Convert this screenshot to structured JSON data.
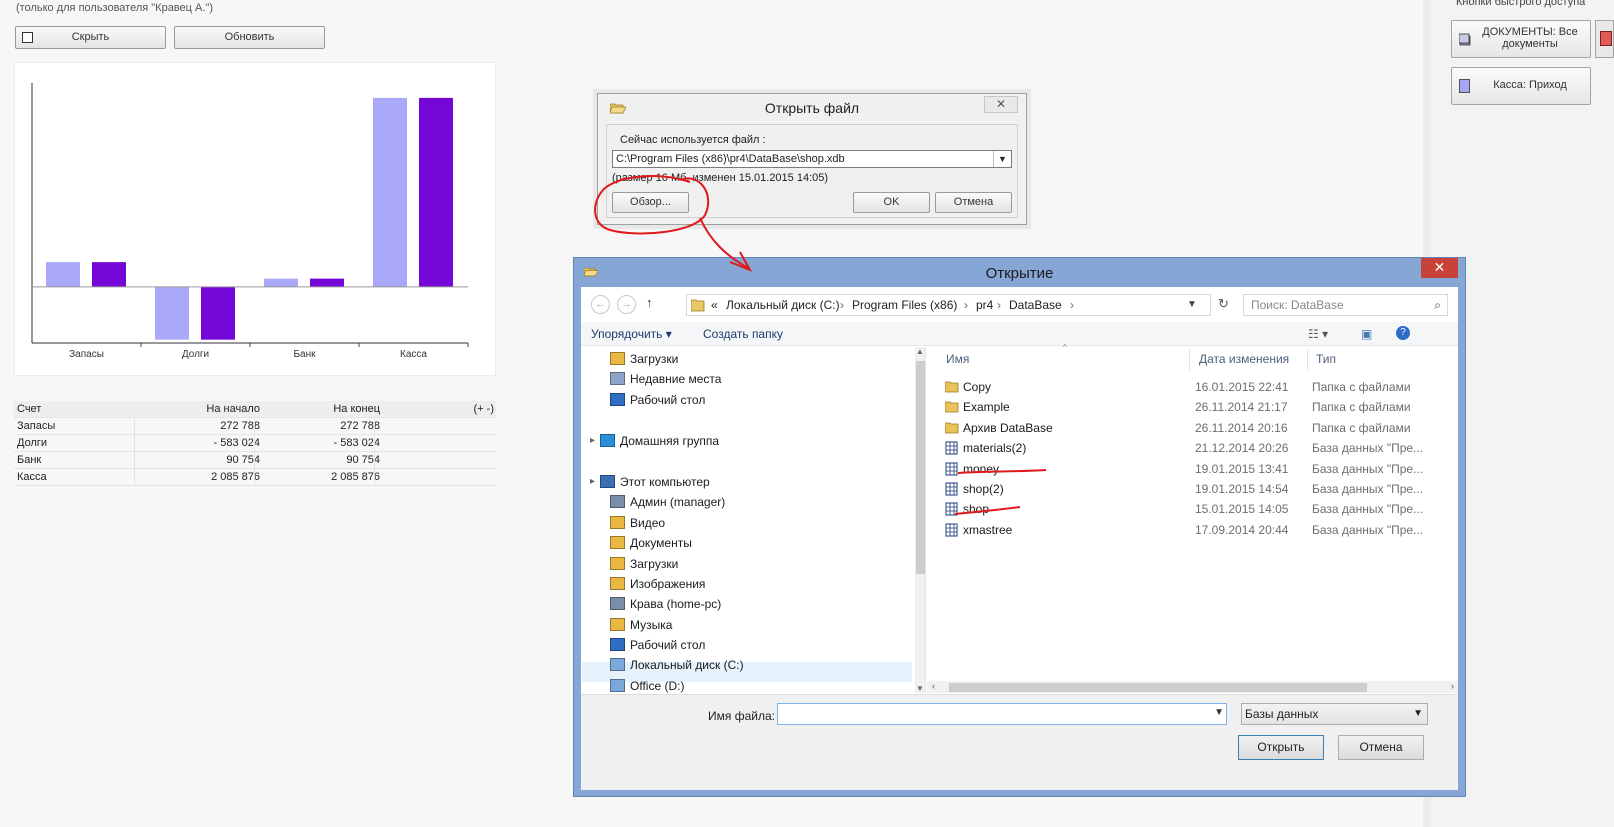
{
  "top": {
    "hint": "(только для пользователя \"Кравец А.\")",
    "hide_label": "Скрыть",
    "refresh_label": "Обновить"
  },
  "chart_data": {
    "type": "bar",
    "categories": [
      "Запасы",
      "Долги",
      "Банк",
      "Касса"
    ],
    "series": [
      {
        "values": [
          272788,
          -583024,
          90754,
          2085876
        ],
        "color": "#aaa8f8"
      },
      {
        "values": [
          272788,
          -583024,
          90754,
          2085876
        ],
        "color": "#7406d8"
      }
    ],
    "xlabel": "",
    "ylabel": "",
    "ylim": [
      -620000,
      2250000
    ],
    "grid": false
  },
  "table": {
    "headers": [
      "Счет",
      "На начало",
      "На конец",
      "(+ -)"
    ],
    "rows": [
      [
        "Запасы",
        "272 788",
        "272 788",
        ""
      ],
      [
        "Долги",
        "- 583 024",
        "- 583 024",
        ""
      ],
      [
        "Банк",
        "90 754",
        "90 754",
        ""
      ],
      [
        "Касса",
        "2 085 876",
        "2 085 876",
        ""
      ]
    ]
  },
  "quick": {
    "title": "Кнопки быстрого доступа",
    "docs_label": "ДОКУМЕНТЫ: Все документы",
    "cash_label": "Касса: Приход"
  },
  "open_dialog": {
    "title": "Открыть файл",
    "close": "✕",
    "current_label": "Сейчас используется файл :",
    "path": "C:\\Program Files (x86)\\pr4\\DataBase\\shop.xdb",
    "info": "(размер 16 Мб, изменен 15.01.2015 14:05)",
    "browse": "Обзор...",
    "ok": "OK",
    "cancel": "Отмена"
  },
  "explorer": {
    "title": "Открытие",
    "close": "✕",
    "address": [
      "«",
      "Локальный диск (C:)",
      "Program Files (x86)",
      "pr4",
      "DataBase"
    ],
    "search_placeholder": "Поиск: DataBase",
    "organize": "Упорядочить ▾",
    "new_folder": "Создать папку",
    "tree": [
      {
        "label": "Загрузки",
        "icon": "downloads-icon",
        "indent": 1
      },
      {
        "label": "Недавние места",
        "icon": "recent-icon",
        "indent": 1
      },
      {
        "label": "Рабочий стол",
        "icon": "desktop-icon",
        "indent": 1
      },
      {
        "label": "Домашняя группа",
        "icon": "homegroup-icon",
        "indent": 0
      },
      {
        "label": "Этот компьютер",
        "icon": "computer-icon",
        "indent": 0
      },
      {
        "label": "Админ (manager)",
        "icon": "network-pc-icon",
        "indent": 1
      },
      {
        "label": "Видео",
        "icon": "video-icon",
        "indent": 1
      },
      {
        "label": "Документы",
        "icon": "documents-icon",
        "indent": 1
      },
      {
        "label": "Загрузки",
        "icon": "downloads-icon",
        "indent": 1
      },
      {
        "label": "Изображения",
        "icon": "pictures-icon",
        "indent": 1
      },
      {
        "label": "Крава (home-pc)",
        "icon": "network-pc-icon",
        "indent": 1
      },
      {
        "label": "Музыка",
        "icon": "music-icon",
        "indent": 1
      },
      {
        "label": "Рабочий стол",
        "icon": "desktop-icon",
        "indent": 1
      },
      {
        "label": "Локальный диск (C:)",
        "icon": "drive-icon",
        "indent": 1
      },
      {
        "label": "Office (D:)",
        "icon": "drive-icon",
        "indent": 1
      }
    ],
    "columns": [
      "Имя",
      "Дата изменения",
      "Тип"
    ],
    "files": [
      {
        "name": "Copy",
        "date": "16.01.2015 22:41",
        "type": "Папка с файлами",
        "kind": "folder"
      },
      {
        "name": "Example",
        "date": "26.11.2014 21:17",
        "type": "Папка с файлами",
        "kind": "folder"
      },
      {
        "name": "Архив DataBase",
        "date": "26.11.2014 20:16",
        "type": "Папка с файлами",
        "kind": "folder"
      },
      {
        "name": "materials(2)",
        "date": "21.12.2014 20:26",
        "type": "База данных \"Пре...",
        "kind": "db"
      },
      {
        "name": "money",
        "date": "19.01.2015 13:41",
        "type": "База данных \"Пре...",
        "kind": "db"
      },
      {
        "name": "shop(2)",
        "date": "19.01.2015 14:54",
        "type": "База данных \"Пре...",
        "kind": "db"
      },
      {
        "name": "shop",
        "date": "15.01.2015 14:05",
        "type": "База данных \"Пре...",
        "kind": "db"
      },
      {
        "name": "xmastree",
        "date": "17.09.2014 20:44",
        "type": "База данных \"Пре...",
        "kind": "db"
      }
    ],
    "filename_label": "Имя файла:",
    "filename_value": "",
    "filetype": "Базы данных",
    "open": "Открыть",
    "cancel": "Отмена"
  },
  "colors": {
    "series_light": "#aaa8f8",
    "series_dark": "#7406d8",
    "annotation": "#e0191d",
    "explorer_frame": "#86a6d6",
    "close_red": "#c7433a"
  }
}
